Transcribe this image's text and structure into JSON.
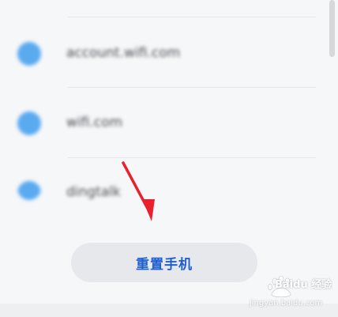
{
  "list": {
    "items": [
      {
        "label": "account.wifi.com",
        "icon": "globe-icon"
      },
      {
        "label": "wifi.com",
        "icon": "globe-icon"
      },
      {
        "label": "dingtalk",
        "icon": "dingtalk-icon"
      }
    ]
  },
  "reset_button": {
    "label": "重置手机"
  },
  "watermark": {
    "text": "Baidu 经验",
    "url": "jingyan.baidu.com"
  },
  "colors": {
    "accent": "#1f5fd1",
    "icon_blue": "#5aaaf0",
    "arrow_red": "#e8212d",
    "background": "#f6f7f9"
  }
}
